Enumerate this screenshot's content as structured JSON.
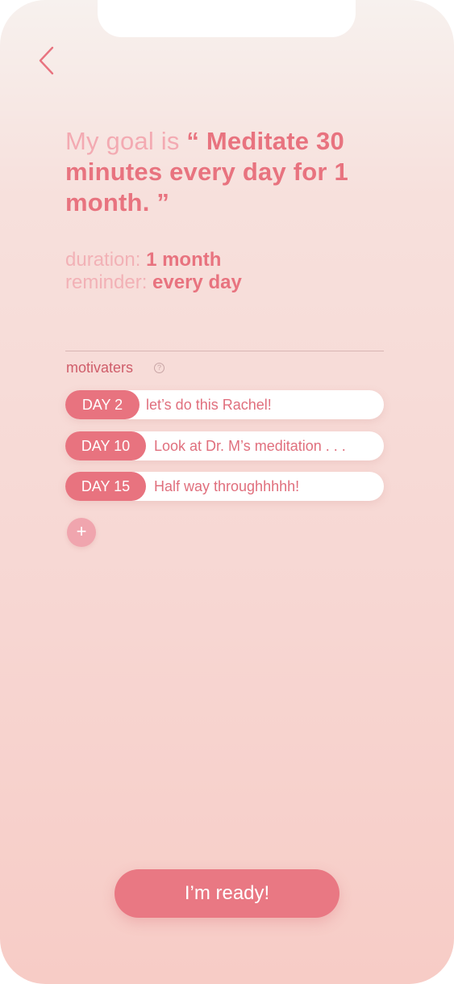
{
  "colors": {
    "accent": "#e8737f",
    "accent_light": "#f3aab2",
    "background_top": "#f7f1ee",
    "background_bottom": "#f7ccc6"
  },
  "nav": {
    "back_icon": "chevron-left-icon"
  },
  "goal": {
    "lead": "My goal is ",
    "text": "“ Meditate 30 minutes every day for 1 month. ”"
  },
  "duration": {
    "label": "duration:",
    "value": "1 month"
  },
  "reminder": {
    "label": "reminder:",
    "value": "every day"
  },
  "motivaters": {
    "title": "motivaters",
    "help_icon": "?",
    "items": [
      {
        "day": "DAY 2",
        "message": "let’s do this Rachel!"
      },
      {
        "day": "DAY 10",
        "message": "Look at Dr. M’s meditation . . ."
      },
      {
        "day": "DAY 15",
        "message": "Half way throughhhhh!"
      }
    ],
    "add_label": "+"
  },
  "cta": {
    "label": "I’m ready!"
  }
}
